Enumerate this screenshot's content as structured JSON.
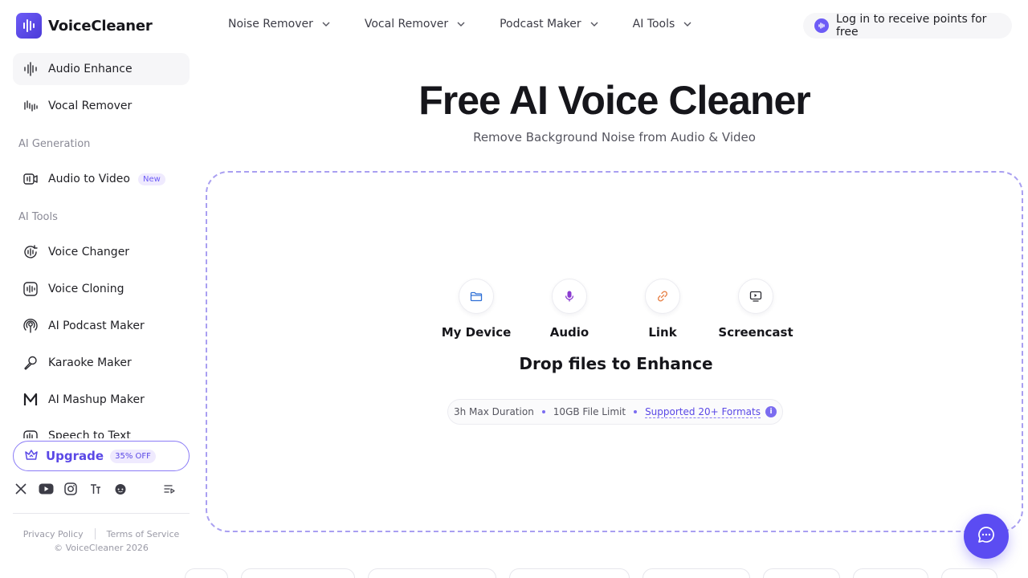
{
  "brand": {
    "name": "VoiceCleaner",
    "accent": "#6d5cf6"
  },
  "nav": {
    "items": [
      {
        "label": "Noise Remover"
      },
      {
        "label": "Vocal Remover"
      },
      {
        "label": "Podcast Maker"
      },
      {
        "label": "AI Tools"
      }
    ],
    "login_label": "Log in to receive points for free"
  },
  "sidebar": {
    "top_items": [
      {
        "label": "Audio Enhance",
        "icon": "audio-enhance-icon",
        "active": true
      },
      {
        "label": "Vocal Remover",
        "icon": "vocal-remover-icon"
      }
    ],
    "section_generation": "AI Generation",
    "generation_items": [
      {
        "label": "Audio to Video",
        "icon": "audio-to-video-icon",
        "badge": "New"
      }
    ],
    "section_tools": "AI Tools",
    "tool_items": [
      {
        "label": "Voice Changer",
        "icon": "voice-changer-icon"
      },
      {
        "label": "Voice Cloning",
        "icon": "voice-cloning-icon"
      },
      {
        "label": "AI Podcast Maker",
        "icon": "podcast-icon"
      },
      {
        "label": "Karaoke Maker",
        "icon": "microphone-icon"
      },
      {
        "label": "AI Mashup Maker",
        "icon": "mashup-icon"
      },
      {
        "label": "Speech to Text",
        "icon": "speech-to-text-icon"
      }
    ],
    "upgrade": {
      "label": "Upgrade",
      "badge": "35% OFF"
    },
    "socials": [
      "x-icon",
      "youtube-icon",
      "instagram-icon",
      "threads-icon",
      "reddit-icon"
    ],
    "legal": {
      "privacy": "Privacy Policy",
      "terms": "Terms of Service",
      "copyright": "© VoiceCleaner 2026"
    }
  },
  "hero": {
    "title": "Free AI Voice Cleaner",
    "subtitle": "Remove Background Noise from Audio & Video"
  },
  "upload": {
    "sources": [
      {
        "label": "My Device",
        "icon": "folder-icon"
      },
      {
        "label": "Audio",
        "icon": "microphone-icon"
      },
      {
        "label": "Link",
        "icon": "link-icon"
      },
      {
        "label": "Screencast",
        "icon": "screencast-icon"
      }
    ],
    "drop_title": "Drop files to Enhance",
    "limits": {
      "duration": "3h Max Duration",
      "size": "10GB File Limit",
      "formats": "Supported 20+ Formats"
    }
  }
}
